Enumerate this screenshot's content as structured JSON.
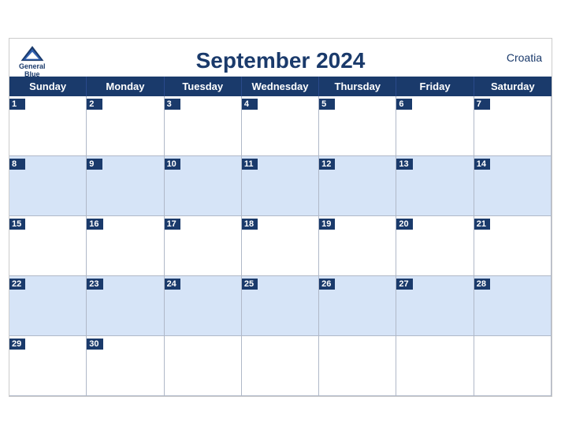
{
  "calendar": {
    "title": "September 2024",
    "country": "Croatia",
    "logo": {
      "line1": "General",
      "line2": "Blue"
    },
    "days": [
      "Sunday",
      "Monday",
      "Tuesday",
      "Wednesday",
      "Thursday",
      "Friday",
      "Saturday"
    ],
    "weeks": [
      [
        {
          "date": "1",
          "empty": false
        },
        {
          "date": "2",
          "empty": false
        },
        {
          "date": "3",
          "empty": false
        },
        {
          "date": "4",
          "empty": false
        },
        {
          "date": "5",
          "empty": false
        },
        {
          "date": "6",
          "empty": false
        },
        {
          "date": "7",
          "empty": false
        }
      ],
      [
        {
          "date": "8",
          "empty": false
        },
        {
          "date": "9",
          "empty": false
        },
        {
          "date": "10",
          "empty": false
        },
        {
          "date": "11",
          "empty": false
        },
        {
          "date": "12",
          "empty": false
        },
        {
          "date": "13",
          "empty": false
        },
        {
          "date": "14",
          "empty": false
        }
      ],
      [
        {
          "date": "15",
          "empty": false
        },
        {
          "date": "16",
          "empty": false
        },
        {
          "date": "17",
          "empty": false
        },
        {
          "date": "18",
          "empty": false
        },
        {
          "date": "19",
          "empty": false
        },
        {
          "date": "20",
          "empty": false
        },
        {
          "date": "21",
          "empty": false
        }
      ],
      [
        {
          "date": "22",
          "empty": false
        },
        {
          "date": "23",
          "empty": false
        },
        {
          "date": "24",
          "empty": false
        },
        {
          "date": "25",
          "empty": false
        },
        {
          "date": "26",
          "empty": false
        },
        {
          "date": "27",
          "empty": false
        },
        {
          "date": "28",
          "empty": false
        }
      ],
      [
        {
          "date": "29",
          "empty": false
        },
        {
          "date": "30",
          "empty": false
        },
        {
          "date": "",
          "empty": true
        },
        {
          "date": "",
          "empty": true
        },
        {
          "date": "",
          "empty": true
        },
        {
          "date": "",
          "empty": true
        },
        {
          "date": "",
          "empty": true
        }
      ]
    ]
  }
}
